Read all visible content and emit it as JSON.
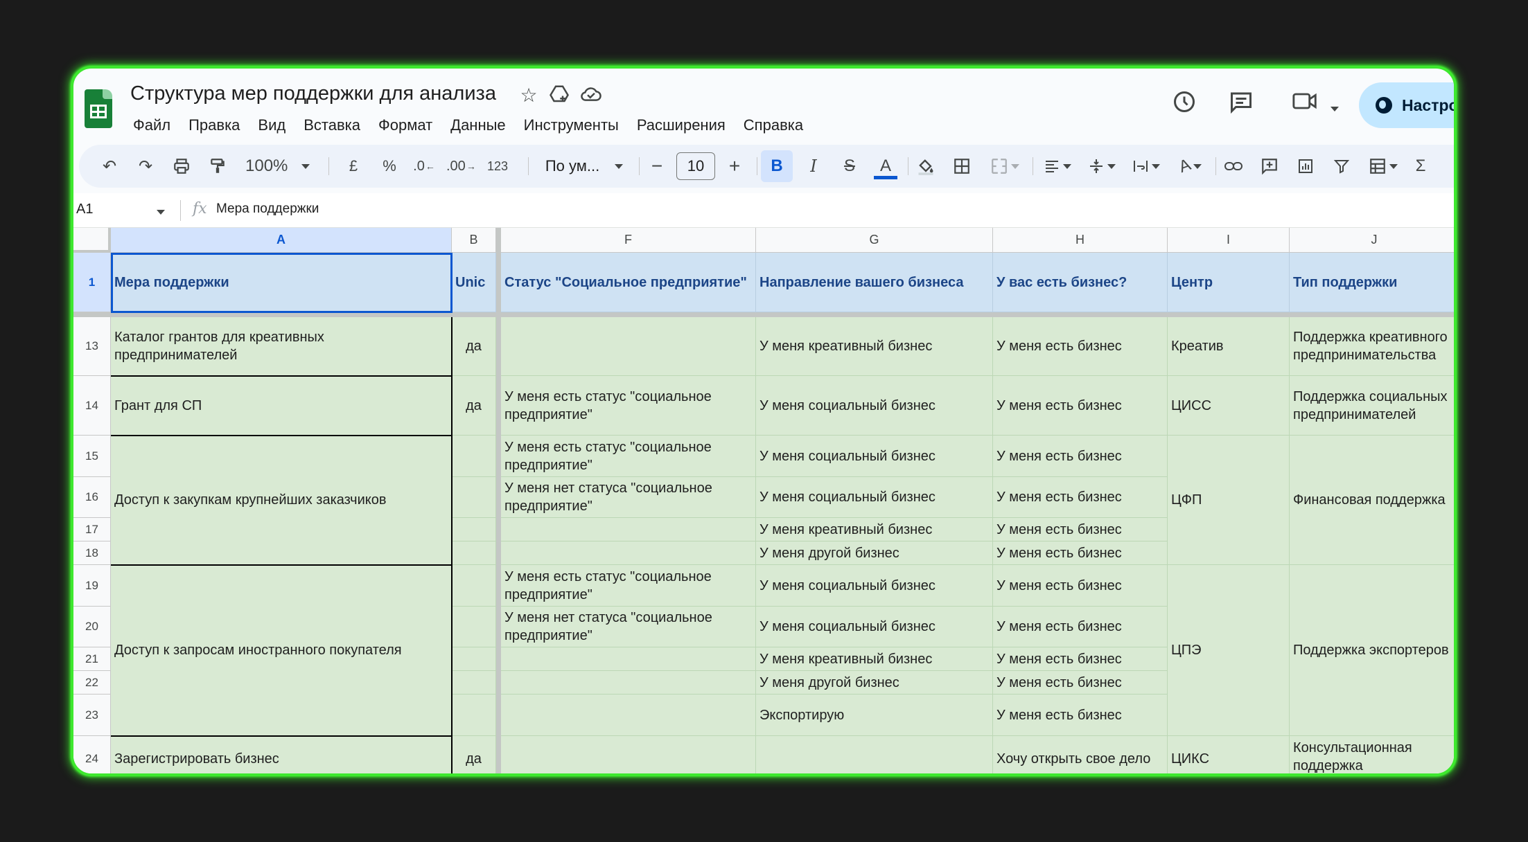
{
  "doc": {
    "title": "Структура мер поддержки для анализа",
    "share_label": "Настро"
  },
  "menu": [
    "Файл",
    "Правка",
    "Вид",
    "Вставка",
    "Формат",
    "Данные",
    "Инструменты",
    "Расширения",
    "Справка"
  ],
  "toolbar": {
    "zoom": "100%",
    "currency": "£",
    "percent": "%",
    "dec_decrease": ".0",
    "dec_increase": ".00",
    "number_format": "123",
    "font": "По ум...",
    "font_size": "10",
    "bold": "B",
    "italic": "I",
    "text_color": "A",
    "sum": "Σ"
  },
  "formula_bar": {
    "cell_ref": "A1",
    "fx": "fx",
    "content": "Мера поддержки"
  },
  "columns": [
    "A",
    "B",
    "F",
    "G",
    "H",
    "I",
    "J"
  ],
  "header_row": {
    "number": "1",
    "cells": [
      "Мера поддержки",
      "Unic",
      "Статус \"Социальное предприятие\"",
      "Направление вашего бизнеса",
      "У вас есть бизнес?",
      "Центр",
      "Тип поддержки"
    ]
  },
  "row_numbers": [
    "13",
    "14",
    "15",
    "16",
    "17",
    "18",
    "19",
    "20",
    "21",
    "22",
    "23",
    "24"
  ],
  "cells": {
    "a13": "Каталог грантов для креативных предпринимателей",
    "a14": "Грант для СП",
    "a15_18": "Доступ к закупкам крупнейших заказчиков",
    "a19_23": "Доступ к запросам иностранного покупателя",
    "a24": "Зарегистрировать бизнес",
    "b13": "да",
    "b14": "да",
    "b24": "да",
    "f14": "У меня есть статус \"социальное предприятие\"",
    "f15": "У меня есть статус \"социальное предприятие\"",
    "f16": "У меня нет статуса \"социальное предприятие\"",
    "f19": "У меня есть статус \"социальное предприятие\"",
    "f20": "У меня нет статуса \"социальное предприятие\"",
    "g13": "У меня креативный бизнес",
    "g14": "У меня социальный бизнес",
    "g15": "У меня социальный бизнес",
    "g16": "У меня социальный бизнес",
    "g17": "У меня креативный бизнес",
    "g18": "У меня другой бизнес",
    "g19": "У меня социальный бизнес",
    "g20": "У меня социальный бизнес",
    "g21": "У меня креативный бизнес",
    "g22": "У меня другой бизнес",
    "g23": "Экспортирую",
    "h13": "У меня есть бизнес",
    "h14": "У меня есть бизнес",
    "h15": "У меня есть бизнес",
    "h16": "У меня есть бизнес",
    "h17": "У меня есть бизнес",
    "h18": "У меня есть бизнес",
    "h19": "У меня есть бизнес",
    "h20": "У меня есть бизнес",
    "h21": "У меня есть бизнес",
    "h22": "У меня есть бизнес",
    "h23": "У меня есть бизнес",
    "h24": "Хочу открыть свое дело",
    "i13": "Креатив",
    "i14": "ЦИСС",
    "i15_18": "ЦФП",
    "i19_23": "ЦПЭ",
    "i24": "ЦИКС",
    "j13": "Поддержка креативного предпринимательства",
    "j14": "Поддержка социальных предпринимателей",
    "j15_18": "Финансовая поддержка",
    "j19_23": "Поддержка экспортеров",
    "j24": "Консультационная поддержка"
  },
  "colors": {
    "window_border": "#3ee82e",
    "header_fill": "#cfe2f3",
    "row_fill": "#d9ead3",
    "selection": "#0b57d0"
  }
}
